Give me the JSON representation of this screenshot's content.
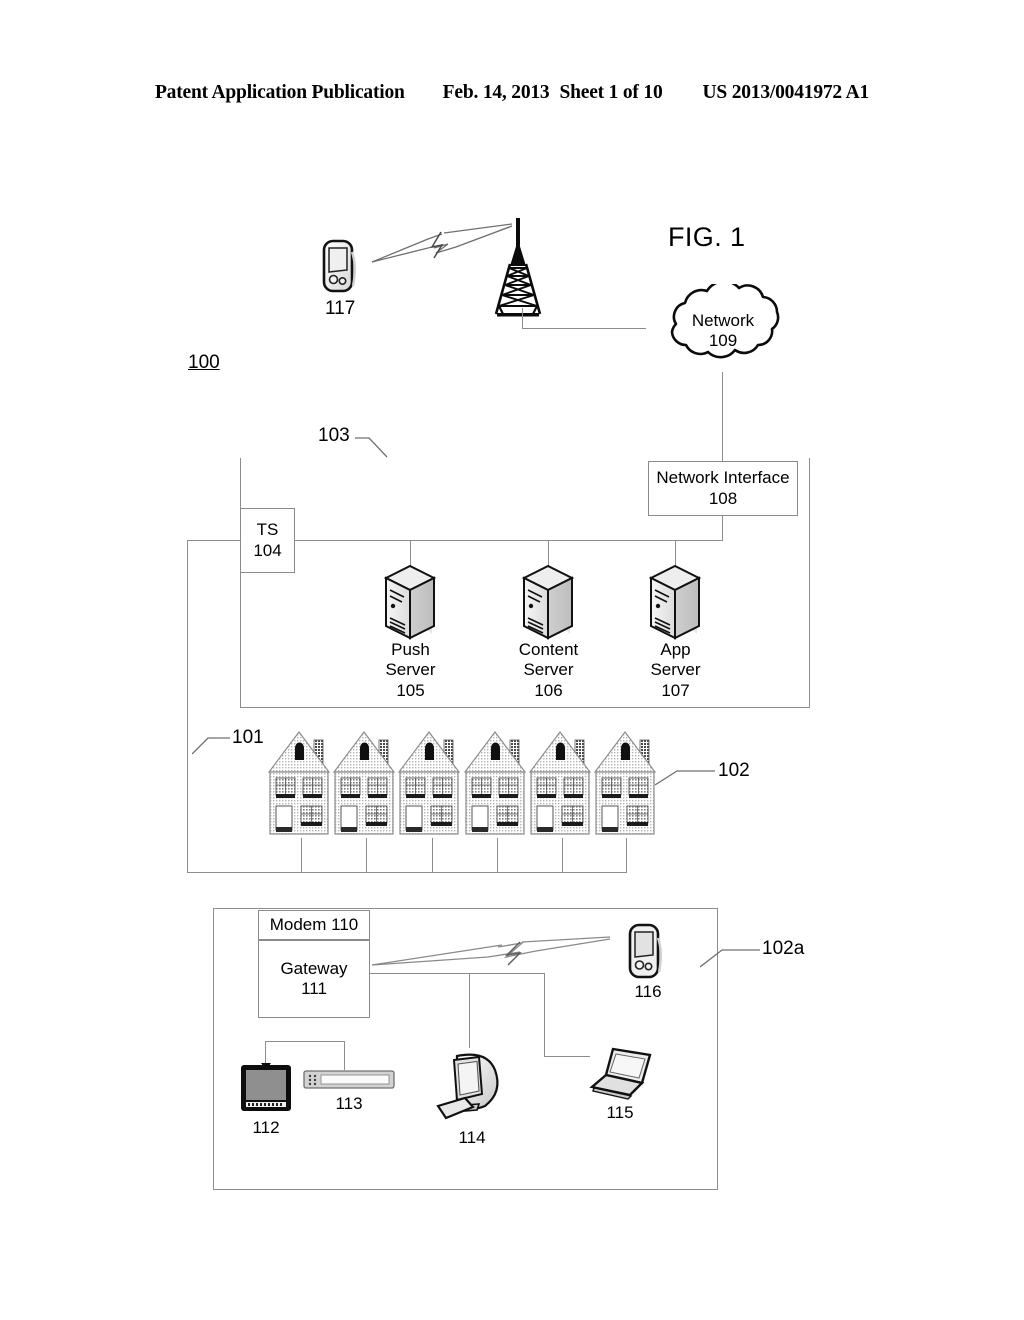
{
  "header": {
    "publication": "Patent Application Publication",
    "date": "Feb. 14, 2013",
    "sheet": "Sheet 1 of 10",
    "number": "US 2013/0041972 A1"
  },
  "figure": {
    "title": "FIG. 1",
    "system_ref": "100"
  },
  "nodes": {
    "mobile_remote": {
      "ref": "117",
      "icon": "mobile-phone-icon"
    },
    "cell_tower": {
      "icon": "cell-tower-icon"
    },
    "network_cloud": {
      "label": "Network",
      "ref": "109",
      "icon": "cloud-icon"
    },
    "network_interface": {
      "label": "Network Interface",
      "ref": "108"
    },
    "termination_system": {
      "label": "TS",
      "ref": "104"
    },
    "headend": {
      "ref": "103"
    },
    "push_server": {
      "label": "Push\nServer",
      "ref": "105",
      "icon": "server-icon"
    },
    "content_server": {
      "label": "Content\nServer",
      "ref": "106",
      "icon": "server-icon"
    },
    "app_server": {
      "label": "App\nServer",
      "ref": "107",
      "icon": "server-icon"
    },
    "links_ref": "101",
    "premises_group_ref": "102",
    "premises_detail_ref": "102a",
    "modem": {
      "label": "Modem 110"
    },
    "gateway": {
      "label": "Gateway",
      "ref": "111"
    },
    "display_device": {
      "ref": "112",
      "icon": "television-icon"
    },
    "set_top_box": {
      "ref": "113",
      "icon": "set-top-box-icon"
    },
    "personal_computer": {
      "ref": "114",
      "icon": "desktop-computer-icon"
    },
    "laptop_computer": {
      "ref": "115",
      "icon": "laptop-icon"
    },
    "wireless_device": {
      "ref": "116",
      "icon": "mobile-phone-icon"
    }
  },
  "houses": {
    "count": 6,
    "icon": "house-icon"
  },
  "colors": {
    "ink": "#000000",
    "wire": "#8d8d8d",
    "paper": "#ffffff"
  }
}
